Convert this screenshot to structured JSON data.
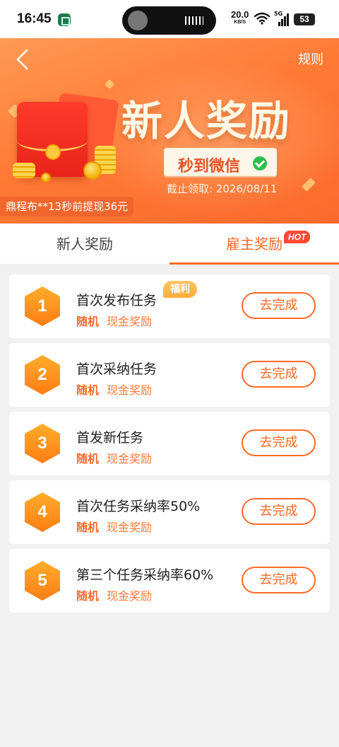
{
  "status_bar": {
    "time": "16:45",
    "net_speed": "20.0",
    "net_unit": "KB/S",
    "signal_label": "5G",
    "battery": "53"
  },
  "header": {
    "back_icon": "chevron-left-icon",
    "rules_label": "规则"
  },
  "banner": {
    "title": "新人奖励",
    "wechat_text": "秒到微信",
    "deadline": "截止领取: 2026/08/11",
    "ticker": "鼎程布**13秒前提现36元"
  },
  "tabs": [
    {
      "label": "新人奖励",
      "active": false
    },
    {
      "label": "雇主奖励",
      "active": true,
      "badge": "HOT"
    }
  ],
  "tasks": [
    {
      "number": "1",
      "title": "首次发布任务",
      "tag": "福利",
      "reward_type": "随机",
      "reward": "现金奖励",
      "button": "去完成"
    },
    {
      "number": "2",
      "title": "首次采纳任务",
      "reward_type": "随机",
      "reward": "现金奖励",
      "button": "去完成"
    },
    {
      "number": "3",
      "title": "首发新任务",
      "reward_type": "随机",
      "reward": "现金奖励",
      "button": "去完成"
    },
    {
      "number": "4",
      "title": "首次任务采纳率50%",
      "reward_type": "随机",
      "reward": "现金奖励",
      "button": "去完成"
    },
    {
      "number": "5",
      "title": "第三个任务采纳率60%",
      "reward_type": "随机",
      "reward": "现金奖励",
      "button": "去完成"
    }
  ],
  "colors": {
    "accent": "#ff6a28",
    "banner": "#ff7a35",
    "background": "#f1f1f1"
  }
}
